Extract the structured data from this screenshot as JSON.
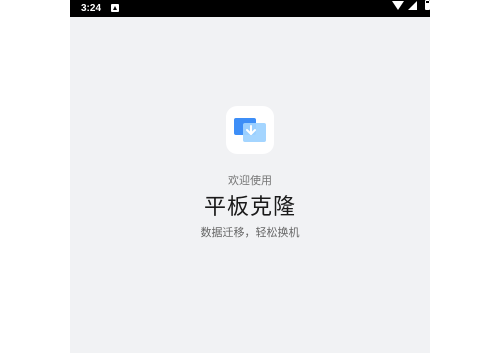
{
  "status_bar": {
    "time": "3:24",
    "notification_icon": "android-notification-icon",
    "wifi_icon": "wifi-icon",
    "signal_icon": "cellular-signal-icon",
    "battery_icon": "battery-icon"
  },
  "splash": {
    "logo_icon": "tablet-clone-app-icon",
    "welcome": "欢迎使用",
    "title": "平板克隆",
    "subtitle": "数据迁移，轻松换机"
  },
  "colors": {
    "background": "#f1f2f4",
    "status_bar": "#000000",
    "logo_blue": "#3d8ef7",
    "logo_light_blue": "#9fd3ff"
  }
}
